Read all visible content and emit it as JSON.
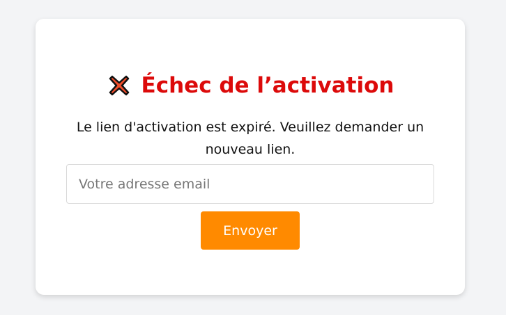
{
  "card": {
    "icon": "cross-mark-icon",
    "title": "Échec de l’activation",
    "message": "Le lien d'activation est expiré. Veuillez demander un nouveau lien.",
    "email": {
      "placeholder": "Votre adresse email",
      "value": ""
    },
    "submit_label": "Envoyer"
  },
  "colors": {
    "background": "#f3f4f6",
    "card": "#ffffff",
    "title": "#dc0a0a",
    "button": "#ff8a00",
    "button_text": "#ffffff"
  }
}
